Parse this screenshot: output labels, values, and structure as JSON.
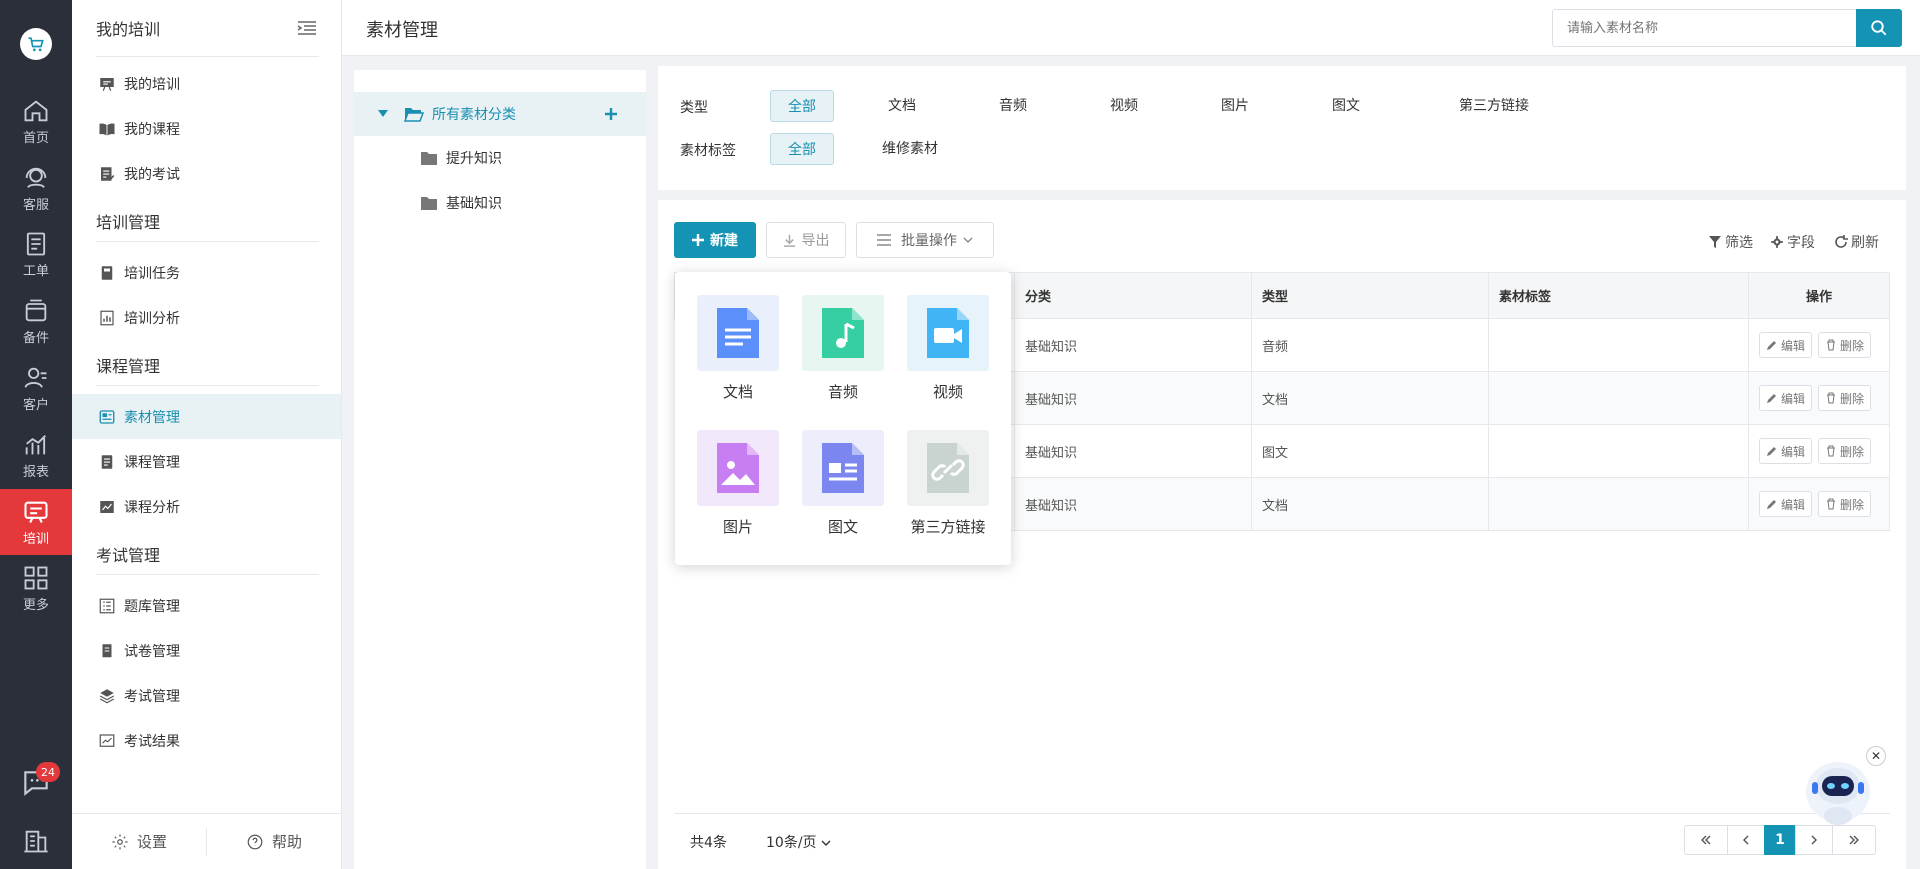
{
  "rail": {
    "items": [
      {
        "label": "首页",
        "icon": "home-icon"
      },
      {
        "label": "客服",
        "icon": "headset-icon"
      },
      {
        "label": "工单",
        "icon": "ticket-icon"
      },
      {
        "label": "备件",
        "icon": "box-icon"
      },
      {
        "label": "客户",
        "icon": "users-icon"
      },
      {
        "label": "报表",
        "icon": "chart-icon"
      },
      {
        "label": "培训",
        "icon": "training-icon"
      },
      {
        "label": "更多",
        "icon": "grid-icon"
      }
    ],
    "active_index": 6,
    "chat_badge": "24"
  },
  "sidebar": {
    "title": "我的培训",
    "items": [
      {
        "label": "我的培训"
      },
      {
        "label": "我的课程"
      },
      {
        "label": "我的考试"
      }
    ],
    "group_training": "培训管理",
    "training_items": [
      {
        "label": "培训任务"
      },
      {
        "label": "培训分析"
      }
    ],
    "group_course": "课程管理",
    "course_items": [
      {
        "label": "素材管理"
      },
      {
        "label": "课程管理"
      },
      {
        "label": "课程分析"
      }
    ],
    "group_exam": "考试管理",
    "exam_items": [
      {
        "label": "题库管理"
      },
      {
        "label": "试卷管理"
      },
      {
        "label": "考试管理"
      },
      {
        "label": "考试结果"
      }
    ],
    "footer": {
      "settings": "设置",
      "help": "帮助"
    }
  },
  "header": {
    "title": "素材管理",
    "search_placeholder": "请输入素材名称"
  },
  "tree": {
    "root": "所有素材分类",
    "children": [
      {
        "label": "提升知识"
      },
      {
        "label": "基础知识"
      }
    ]
  },
  "filters": {
    "type_label": "类型",
    "type_options": [
      "全部",
      "文档",
      "音频",
      "视频",
      "图片",
      "图文",
      "第三方链接"
    ],
    "tag_label": "素材标签",
    "tag_options": [
      "全部",
      "维修素材"
    ]
  },
  "toolbar": {
    "new": "新建",
    "export": "导出",
    "batch": "批量操作",
    "filter": "筛选",
    "fields": "字段",
    "refresh": "刷新"
  },
  "table": {
    "headers": {
      "category": "分类",
      "type": "类型",
      "tag": "素材标签",
      "ops": "操作"
    },
    "rows": [
      {
        "category": "基础知识",
        "type": "音频",
        "tag": ""
      },
      {
        "category": "基础知识",
        "type": "文档",
        "tag": ""
      },
      {
        "category": "基础知识",
        "type": "图文",
        "tag": ""
      },
      {
        "category": "基础知识",
        "type": "文档",
        "tag": ""
      }
    ],
    "edit": "编辑",
    "delete": "删除"
  },
  "new_menu": {
    "items": [
      {
        "label": "文档",
        "icon": "document-icon",
        "color": "#5b8ff9"
      },
      {
        "label": "音频",
        "icon": "music-icon",
        "color": "#36cfa3"
      },
      {
        "label": "视频",
        "icon": "video-icon",
        "color": "#40b4f5"
      },
      {
        "label": "图片",
        "icon": "image-icon",
        "color": "#c77ef2"
      },
      {
        "label": "图文",
        "icon": "article-icon",
        "color": "#7b86f0"
      },
      {
        "label": "第三方链接",
        "icon": "link-icon",
        "color": "#c9d3cf"
      }
    ]
  },
  "pager": {
    "total": "共4条",
    "page_size": "10条/页",
    "current": "1"
  },
  "colors": {
    "accent": "#1493b4",
    "rail_bg": "#2b2f3a",
    "rail_active": "#e5383b"
  }
}
